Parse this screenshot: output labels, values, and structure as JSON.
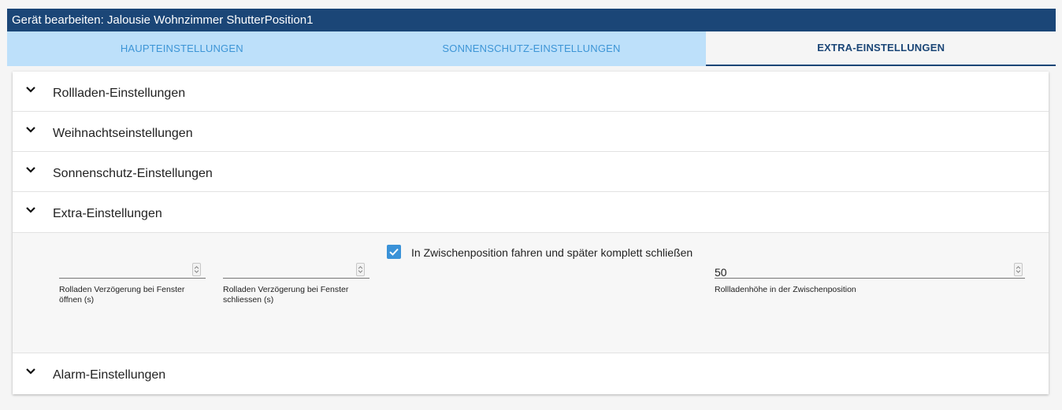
{
  "window": {
    "title": "Gerät bearbeiten: Jalousie Wohnzimmer ShutterPosition1"
  },
  "tabs": [
    {
      "label": "HAUPTEINSTELLUNGEN",
      "active": false
    },
    {
      "label": "SONNENSCHUTZ-EINSTELLUNGEN",
      "active": false
    },
    {
      "label": "EXTRA-EINSTELLUNGEN",
      "active": true
    }
  ],
  "accordion": {
    "items": [
      {
        "label": "Rollladen-Einstellungen",
        "expanded": false,
        "icon": "chevron-down-icon"
      },
      {
        "label": "Weihnachtseinstellungen",
        "expanded": false,
        "icon": "chevron-down-icon"
      },
      {
        "label": "Sonnenschutz-Einstellungen",
        "expanded": false,
        "icon": "chevron-down-icon"
      },
      {
        "label": "Extra-Einstellungen",
        "expanded": true,
        "icon": "chevron-down-icon"
      },
      {
        "label": "Alarm-Einstellungen",
        "expanded": false,
        "icon": "chevron-down-icon"
      }
    ]
  },
  "extra": {
    "delay_open": {
      "value": "",
      "helper_line1": "Rolladen Verzögerung bei Fenster",
      "helper_line2": "öffnen (s)"
    },
    "delay_close": {
      "value": "",
      "helper_line1": "Rolladen Verzögerung bei Fenster",
      "helper_line2": "schliessen (s)"
    },
    "intermediate_checkbox": {
      "checked": true,
      "label": "In Zwischenposition fahren und später komplett schließen"
    },
    "intermediate_height": {
      "value": "50",
      "helper": "Rollladenhöhe in der Zwischenposition"
    }
  },
  "colors": {
    "titlebar": "#1b4677",
    "tab_bar": "#bde0fa",
    "tab_inactive_text": "#3d95d6",
    "tab_active_text": "#1b4677",
    "checkbox": "#3a92d8"
  }
}
